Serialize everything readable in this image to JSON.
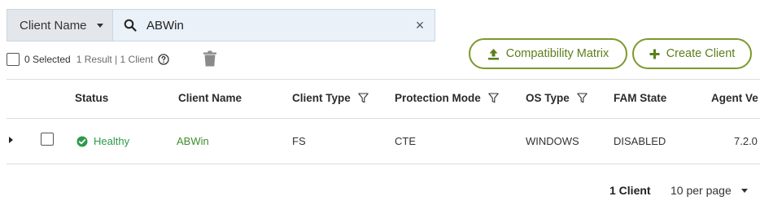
{
  "search": {
    "filter_label": "Client Name",
    "value": "ABWin",
    "clear_label": "×"
  },
  "selection": {
    "selected_text": "0 Selected",
    "results_text": "1 Result | 1 Client"
  },
  "actions": {
    "compat_label": "Compatibility Matrix",
    "create_label": "Create Client"
  },
  "table": {
    "columns": [
      "Status",
      "Client Name",
      "Client Type",
      "Protection Mode",
      "OS Type",
      "FAM State",
      "Agent Ve"
    ],
    "rows": [
      {
        "status": "Healthy",
        "client_name": "ABWin",
        "client_type": "FS",
        "protection_mode": "CTE",
        "os_type": "WINDOWS",
        "fam_state": "DISABLED",
        "agent_version": "7.2.0"
      }
    ]
  },
  "footer": {
    "count": "1 Client",
    "per_page": "10 per page"
  },
  "colors": {
    "accent_green": "#7b9a2c",
    "healthy_green": "#2e9a4a",
    "search_bg": "#eaf1f8"
  },
  "icons": {
    "search": "search-icon",
    "clear": "close-icon",
    "help": "help-icon",
    "trash": "trash-icon",
    "upload": "upload-icon",
    "plus": "plus-icon",
    "filter": "funnel-icon",
    "healthy": "check-circle-icon"
  }
}
